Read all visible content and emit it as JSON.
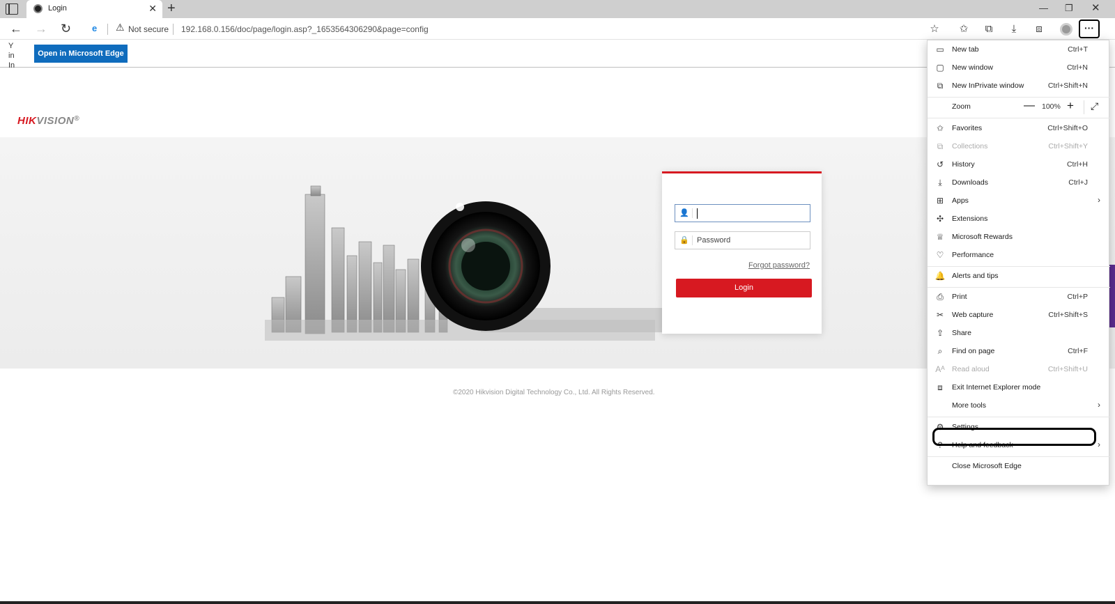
{
  "tab": {
    "title": "Login"
  },
  "address_bar": {
    "security": "Not secure",
    "url": "192.168.0.156/doc/page/login.asp?_1653564306290&page=config"
  },
  "ie_bar": {
    "truncated_text": "Y in In",
    "open_button": "Open in Microsoft Edge"
  },
  "page": {
    "logo_red": "HIK",
    "logo_gray": "VISION",
    "logo_reg": "®",
    "password_placeholder": "Password",
    "forgot_password": "Forgot password?",
    "login_button": "Login",
    "copyright": "©2020 Hikvision Digital Technology Co., Ltd. All Rights Reserved."
  },
  "menu": {
    "items": [
      {
        "label": "New tab",
        "shortcut": "Ctrl+T",
        "icon": "new-tab-icon"
      },
      {
        "label": "New window",
        "shortcut": "Ctrl+N",
        "icon": "new-window-icon"
      },
      {
        "label": "New InPrivate window",
        "shortcut": "Ctrl+Shift+N",
        "icon": "inprivate-icon"
      },
      {
        "label": "Zoom",
        "value": "100%"
      },
      {
        "label": "Favorites",
        "shortcut": "Ctrl+Shift+O",
        "icon": "favorites-icon"
      },
      {
        "label": "Collections",
        "shortcut": "Ctrl+Shift+Y",
        "icon": "collections-icon"
      },
      {
        "label": "History",
        "shortcut": "Ctrl+H",
        "icon": "history-icon"
      },
      {
        "label": "Downloads",
        "shortcut": "Ctrl+J",
        "icon": "downloads-icon"
      },
      {
        "label": "Apps",
        "icon": "apps-icon"
      },
      {
        "label": "Extensions",
        "icon": "extensions-icon"
      },
      {
        "label": "Microsoft Rewards",
        "icon": "rewards-icon"
      },
      {
        "label": "Performance",
        "icon": "performance-icon"
      },
      {
        "label": "Alerts and tips",
        "icon": "bell-icon"
      },
      {
        "label": "Print",
        "shortcut": "Ctrl+P",
        "icon": "print-icon"
      },
      {
        "label": "Web capture",
        "shortcut": "Ctrl+Shift+S",
        "icon": "web-capture-icon"
      },
      {
        "label": "Share",
        "icon": "share-icon"
      },
      {
        "label": "Find on page",
        "shortcut": "Ctrl+F",
        "icon": "find-icon"
      },
      {
        "label": "Read aloud",
        "shortcut": "Ctrl+Shift+U",
        "icon": "read-aloud-icon"
      },
      {
        "label": "Exit Internet Explorer mode",
        "icon": "ie-mode-icon"
      },
      {
        "label": "More tools"
      },
      {
        "label": "Settings",
        "icon": "gear-icon"
      },
      {
        "label": "Help and feedback",
        "icon": "help-icon"
      },
      {
        "label": "Close Microsoft Edge"
      }
    ]
  }
}
